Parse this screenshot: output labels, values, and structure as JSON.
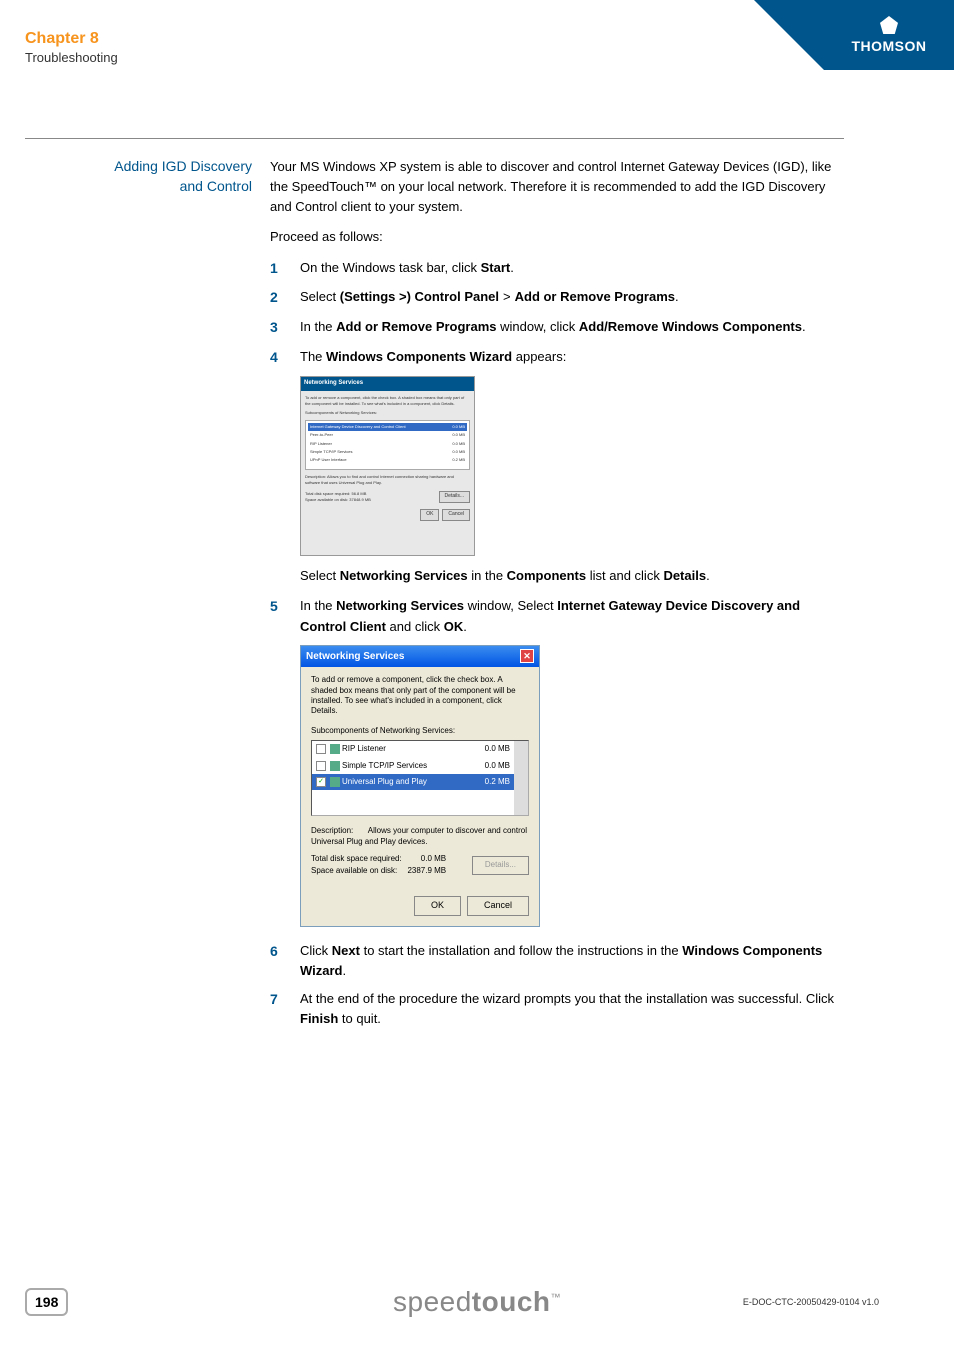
{
  "header": {
    "chapter": "Chapter 8",
    "subtitle": "Troubleshooting",
    "logo_text": "THOMSON"
  },
  "section": {
    "label_line1": "Adding IGD Discovery",
    "label_line2": "and Control",
    "intro": "Your MS Windows XP system is able to discover and control Internet Gateway Devices (IGD), like the SpeedTouch™ on your local network. Therefore it is recommended to add the IGD Discovery and Control client to your system.",
    "proceed": "Proceed as follows:"
  },
  "steps": {
    "s1": {
      "num": "1",
      "pre": "On the Windows task bar, click ",
      "b1": "Start",
      "post": "."
    },
    "s2": {
      "num": "2",
      "pre": "Select ",
      "b1": "(Settings >) Control Panel",
      "gt": ">",
      "b2": "Add or Remove Programs",
      "post": "."
    },
    "s3": {
      "num": "3",
      "pre": "In the ",
      "b1": "Add or Remove Programs",
      "mid": " window, click ",
      "b2": "Add/Remove Windows Components",
      "post": "."
    },
    "s4": {
      "num": "4",
      "pre": "The ",
      "b1": "Windows Components Wizard",
      "post": " appears:"
    },
    "s4_sub": {
      "pre": "Select ",
      "b1": "Networking Services",
      "mid": " in the ",
      "b2": "Components",
      "mid2": " list and click ",
      "b3": "Details",
      "post": "."
    },
    "s5": {
      "num": "5",
      "pre": "In the ",
      "b1": "Networking Services",
      "mid": " window, Select ",
      "b2": "Internet Gateway Device Discovery and Control Client",
      "mid2": " and click ",
      "b3": "OK",
      "post": "."
    },
    "s6": {
      "num": "6",
      "pre": "Click ",
      "b1": "Next",
      "mid": " to start the installation and follow the instructions in the ",
      "b2": "Windows Components Wizard",
      "post": "."
    },
    "s7": {
      "num": "7",
      "pre": "At the end of the procedure the wizard prompts you that the installation was successful. Click ",
      "b1": "Finish",
      "post": " to quit."
    }
  },
  "wizard1": {
    "title": "Networking Services",
    "instr": "To add or remove a component, click the check box. A shaded box means that only part of the component will be installed. To see what's included in a component, click Details.",
    "sub_label": "Subcomponents of Networking Services:",
    "rows": [
      {
        "name": "Internet Gateway Device Discovery and Control Client",
        "size": "0.0 MB"
      },
      {
        "name": "Peer-to-Peer",
        "size": "0.0 MB"
      },
      {
        "name": "RIP Listener",
        "size": "0.0 MB"
      },
      {
        "name": "Simple TCP/IP Services",
        "size": "0.0 MB"
      },
      {
        "name": "UPnP User Interface",
        "size": "0.2 MB"
      }
    ],
    "desc_label": "Description:",
    "desc": "Allows you to find and control Internet connection sharing hardware and software that uses Universal Plug and Play.",
    "total_label": "Total disk space required:",
    "total_val": "56.8 MB",
    "avail_label": "Space available on disk:",
    "avail_val": "37848.9 MB",
    "details_btn": "Details...",
    "ok": "OK",
    "cancel": "Cancel"
  },
  "dialog": {
    "title": "Networking Services",
    "instr": "To add or remove a component, click the check box. A shaded box means that only part of the component will be installed. To see what's included in a component, click Details.",
    "sub_label": "Subcomponents of Networking Services:",
    "rows": {
      "r0": {
        "name": "RIP Listener",
        "size": "0.0 MB",
        "checked": ""
      },
      "r1": {
        "name": "Simple TCP/IP Services",
        "size": "0.0 MB",
        "checked": ""
      },
      "r2": {
        "name": "Universal Plug and Play",
        "size": "0.2 MB",
        "checked": "✓"
      }
    },
    "desc_label": "Description:",
    "desc": "Allows your computer to discover and control Universal Plug and Play devices.",
    "total_label": "Total disk space required:",
    "total_val": "0.0 MB",
    "avail_label": "Space available on disk:",
    "avail_val": "2387.9 MB",
    "details_btn": "Details...",
    "ok": "OK",
    "cancel": "Cancel"
  },
  "footer": {
    "page": "198",
    "logo_light": "speed",
    "logo_bold": "touch",
    "tm": "™",
    "doc_id": "E-DOC-CTC-20050429-0104 v1.0"
  }
}
